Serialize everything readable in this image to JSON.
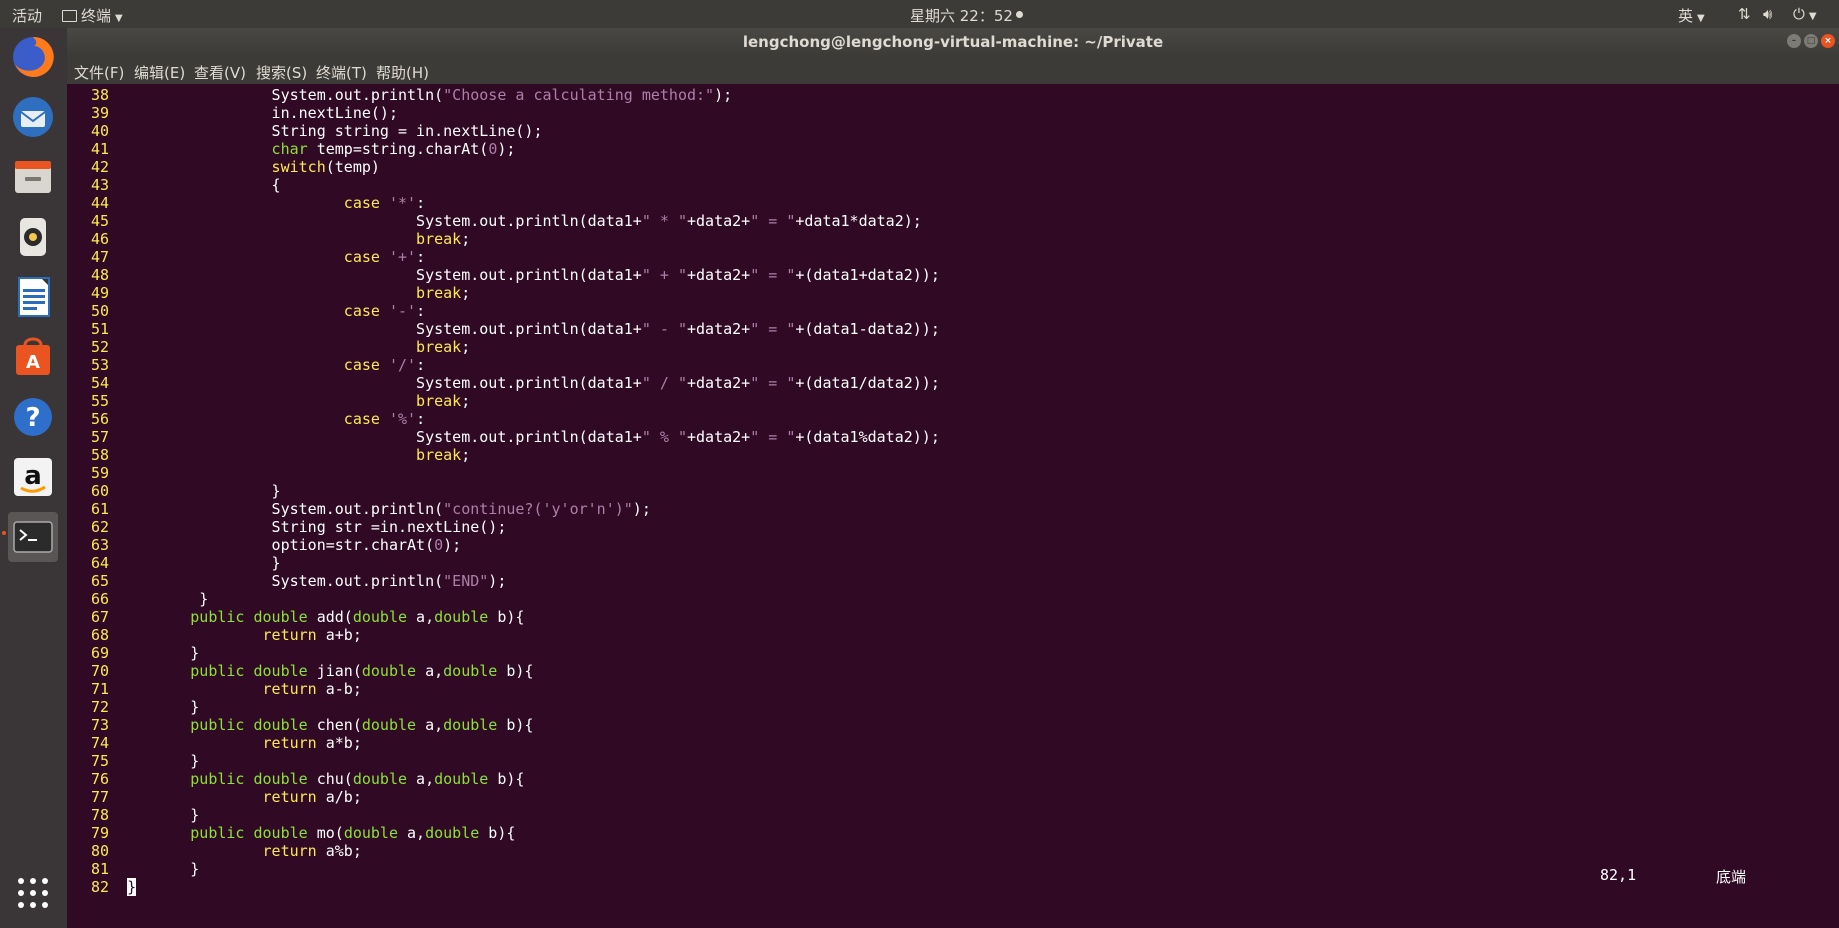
{
  "top_panel": {
    "activities": "活动",
    "app_menu": "终端",
    "clock": "星期六 22：52",
    "input_method": "英"
  },
  "dock": {
    "items": [
      "firefox-icon",
      "thunderbird-icon",
      "files-icon",
      "rhythmbox-icon",
      "writer-icon",
      "software-icon",
      "help-icon",
      "amazon-icon",
      "terminal-icon",
      "app-grid-icon"
    ]
  },
  "window": {
    "title": "lengchong@lengchong-virtual-machine: ~/Private",
    "menu": [
      "文件(F)",
      "编辑(E)",
      "查看(V)",
      "搜索(S)",
      "终端(T)",
      "帮助(H)"
    ]
  },
  "editor": {
    "lines": [
      {
        "n": "38",
        "tokens": [
          [
            "plain",
            "                System.out.println("
          ],
          [
            "str",
            "\"Choose a calculating method:\""
          ],
          [
            "plain",
            ");"
          ]
        ]
      },
      {
        "n": "39",
        "tokens": [
          [
            "plain",
            "                in.nextLine();"
          ]
        ]
      },
      {
        "n": "40",
        "tokens": [
          [
            "plain",
            "                String string = in.nextLine();"
          ]
        ]
      },
      {
        "n": "41",
        "tokens": [
          [
            "type",
            "                char"
          ],
          [
            "plain",
            " temp=string.charAt("
          ],
          [
            "num",
            "0"
          ],
          [
            "plain",
            ");"
          ]
        ]
      },
      {
        "n": "42",
        "tokens": [
          [
            "kw",
            "                switch"
          ],
          [
            "plain",
            "(temp)"
          ]
        ]
      },
      {
        "n": "43",
        "tokens": [
          [
            "plain",
            "                {"
          ]
        ]
      },
      {
        "n": "44",
        "tokens": [
          [
            "kw",
            "                        case"
          ],
          [
            "plain",
            " "
          ],
          [
            "str",
            "'*'"
          ],
          [
            "plain",
            ":"
          ]
        ]
      },
      {
        "n": "45",
        "tokens": [
          [
            "plain",
            "                                System.out.println(data1+"
          ],
          [
            "str",
            "\" * \""
          ],
          [
            "plain",
            "+data2+"
          ],
          [
            "str",
            "\" = \""
          ],
          [
            "plain",
            "+data1*data2);"
          ]
        ]
      },
      {
        "n": "46",
        "tokens": [
          [
            "kw",
            "                                break"
          ],
          [
            "plain",
            ";"
          ]
        ]
      },
      {
        "n": "47",
        "tokens": [
          [
            "kw",
            "                        case"
          ],
          [
            "plain",
            " "
          ],
          [
            "str",
            "'+'"
          ],
          [
            "plain",
            ":"
          ]
        ]
      },
      {
        "n": "48",
        "tokens": [
          [
            "plain",
            "                                System.out.println(data1+"
          ],
          [
            "str",
            "\" + \""
          ],
          [
            "plain",
            "+data2+"
          ],
          [
            "str",
            "\" = \""
          ],
          [
            "plain",
            "+(data1+data2));"
          ]
        ]
      },
      {
        "n": "49",
        "tokens": [
          [
            "kw",
            "                                break"
          ],
          [
            "plain",
            ";"
          ]
        ]
      },
      {
        "n": "50",
        "tokens": [
          [
            "kw",
            "                        case"
          ],
          [
            "plain",
            " "
          ],
          [
            "str",
            "'-'"
          ],
          [
            "plain",
            ":"
          ]
        ]
      },
      {
        "n": "51",
        "tokens": [
          [
            "plain",
            "                                System.out.println(data1+"
          ],
          [
            "str",
            "\" - \""
          ],
          [
            "plain",
            "+data2+"
          ],
          [
            "str",
            "\" = \""
          ],
          [
            "plain",
            "+(data1-data2));"
          ]
        ]
      },
      {
        "n": "52",
        "tokens": [
          [
            "kw",
            "                                break"
          ],
          [
            "plain",
            ";"
          ]
        ]
      },
      {
        "n": "53",
        "tokens": [
          [
            "kw",
            "                        case"
          ],
          [
            "plain",
            " "
          ],
          [
            "str",
            "'/'"
          ],
          [
            "plain",
            ":"
          ]
        ]
      },
      {
        "n": "54",
        "tokens": [
          [
            "plain",
            "                                System.out.println(data1+"
          ],
          [
            "str",
            "\" / \""
          ],
          [
            "plain",
            "+data2+"
          ],
          [
            "str",
            "\" = \""
          ],
          [
            "plain",
            "+(data1/data2));"
          ]
        ]
      },
      {
        "n": "55",
        "tokens": [
          [
            "kw",
            "                                break"
          ],
          [
            "plain",
            ";"
          ]
        ]
      },
      {
        "n": "56",
        "tokens": [
          [
            "kw",
            "                        case"
          ],
          [
            "plain",
            " "
          ],
          [
            "str",
            "'%'"
          ],
          [
            "plain",
            ":"
          ]
        ]
      },
      {
        "n": "57",
        "tokens": [
          [
            "plain",
            "                                System.out.println(data1+"
          ],
          [
            "str",
            "\" % \""
          ],
          [
            "plain",
            "+data2+"
          ],
          [
            "str",
            "\" = \""
          ],
          [
            "plain",
            "+(data1%data2));"
          ]
        ]
      },
      {
        "n": "58",
        "tokens": [
          [
            "kw",
            "                                break"
          ],
          [
            "plain",
            ";"
          ]
        ]
      },
      {
        "n": "59",
        "tokens": [
          [
            "plain",
            ""
          ]
        ]
      },
      {
        "n": "60",
        "tokens": [
          [
            "plain",
            "                }"
          ]
        ]
      },
      {
        "n": "61",
        "tokens": [
          [
            "plain",
            "                System.out.println("
          ],
          [
            "str",
            "\"continue?('y'or'n')\""
          ],
          [
            "plain",
            ");"
          ]
        ]
      },
      {
        "n": "62",
        "tokens": [
          [
            "plain",
            "                String str =in.nextLine();"
          ]
        ]
      },
      {
        "n": "63",
        "tokens": [
          [
            "plain",
            "                option=str.charAt("
          ],
          [
            "num",
            "0"
          ],
          [
            "plain",
            ");"
          ]
        ]
      },
      {
        "n": "64",
        "tokens": [
          [
            "plain",
            "                }"
          ]
        ]
      },
      {
        "n": "65",
        "tokens": [
          [
            "plain",
            "                System.out.println("
          ],
          [
            "str",
            "\"END\""
          ],
          [
            "plain",
            ");"
          ]
        ]
      },
      {
        "n": "66",
        "tokens": [
          [
            "plain",
            "        }"
          ]
        ]
      },
      {
        "n": "67",
        "tokens": [
          [
            "type",
            "       public double"
          ],
          [
            "plain",
            " add("
          ],
          [
            "type",
            "double"
          ],
          [
            "plain",
            " a,"
          ],
          [
            "type",
            "double"
          ],
          [
            "plain",
            " b){"
          ]
        ]
      },
      {
        "n": "68",
        "tokens": [
          [
            "kw",
            "               return"
          ],
          [
            "plain",
            " a+b;"
          ]
        ]
      },
      {
        "n": "69",
        "tokens": [
          [
            "plain",
            "       }"
          ]
        ]
      },
      {
        "n": "70",
        "tokens": [
          [
            "type",
            "       public double"
          ],
          [
            "plain",
            " jian("
          ],
          [
            "type",
            "double"
          ],
          [
            "plain",
            " a,"
          ],
          [
            "type",
            "double"
          ],
          [
            "plain",
            " b){"
          ]
        ]
      },
      {
        "n": "71",
        "tokens": [
          [
            "kw",
            "               return"
          ],
          [
            "plain",
            " a-b;"
          ]
        ]
      },
      {
        "n": "72",
        "tokens": [
          [
            "plain",
            "       }"
          ]
        ]
      },
      {
        "n": "73",
        "tokens": [
          [
            "type",
            "       public double"
          ],
          [
            "plain",
            " chen("
          ],
          [
            "type",
            "double"
          ],
          [
            "plain",
            " a,"
          ],
          [
            "type",
            "double"
          ],
          [
            "plain",
            " b){"
          ]
        ]
      },
      {
        "n": "74",
        "tokens": [
          [
            "kw",
            "               return"
          ],
          [
            "plain",
            " a*b;"
          ]
        ]
      },
      {
        "n": "75",
        "tokens": [
          [
            "plain",
            "       }"
          ]
        ]
      },
      {
        "n": "76",
        "tokens": [
          [
            "type",
            "       public double"
          ],
          [
            "plain",
            " chu("
          ],
          [
            "type",
            "double"
          ],
          [
            "plain",
            " a,"
          ],
          [
            "type",
            "double"
          ],
          [
            "plain",
            " b){"
          ]
        ]
      },
      {
        "n": "77",
        "tokens": [
          [
            "kw",
            "               return"
          ],
          [
            "plain",
            " a/b;"
          ]
        ]
      },
      {
        "n": "78",
        "tokens": [
          [
            "plain",
            "       }"
          ]
        ]
      },
      {
        "n": "79",
        "tokens": [
          [
            "type",
            "       public double"
          ],
          [
            "plain",
            " mo("
          ],
          [
            "type",
            "double"
          ],
          [
            "plain",
            " a,"
          ],
          [
            "type",
            "double"
          ],
          [
            "plain",
            " b){"
          ]
        ]
      },
      {
        "n": "80",
        "tokens": [
          [
            "kw",
            "               return"
          ],
          [
            "plain",
            " a%b;"
          ]
        ]
      },
      {
        "n": "81",
        "tokens": [
          [
            "plain",
            "       }"
          ]
        ]
      },
      {
        "n": "82",
        "tokens": [
          [
            "cursor",
            "}"
          ]
        ]
      }
    ],
    "ruler": "82,1",
    "scroll_position": "底端"
  }
}
